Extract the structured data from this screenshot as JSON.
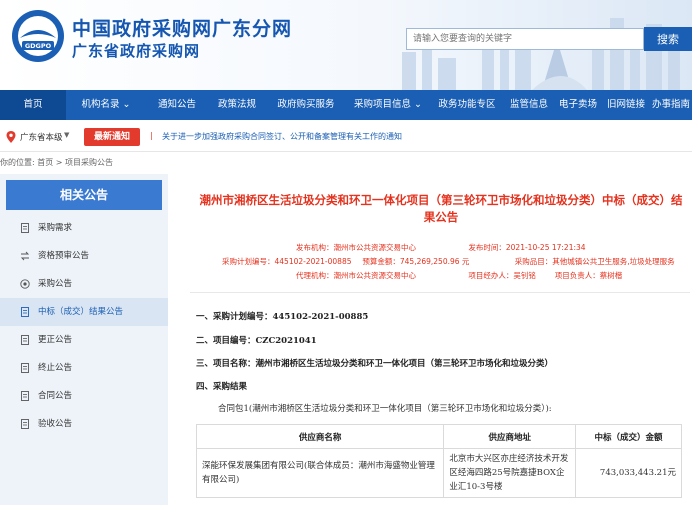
{
  "header": {
    "site_title": "中国政府采购网广东分网",
    "site_subtitle": "广东省政府采购网",
    "logo_text": "GDGPO",
    "search": {
      "placeholder": "请输入您要查询的关键字",
      "button": "搜索"
    }
  },
  "nav": {
    "items": [
      {
        "label": "首页",
        "active": true
      },
      {
        "label": "机构名录 ⌄",
        "active": false
      },
      {
        "label": "通知公告",
        "active": false
      },
      {
        "label": "政策法规",
        "active": false
      },
      {
        "label": "政府购买服务",
        "active": false
      },
      {
        "label": "采购项目信息 ⌄",
        "active": false
      },
      {
        "label": "政务功能专区",
        "active": false
      },
      {
        "label": "监管信息",
        "active": false
      },
      {
        "label": "电子卖场",
        "active": false
      },
      {
        "label": "旧网链接",
        "active": false
      },
      {
        "label": "办事指南",
        "active": false
      }
    ]
  },
  "notice": {
    "location": "广东省本级",
    "badge": "最新通知",
    "separator": "|",
    "text": "关于进一步加强政府采购合同签订、公开和备案管理有关工作的通知"
  },
  "breadcrumb": {
    "text": "你的位置:  首页 > 项目采购公告"
  },
  "sidebar": {
    "title": "相关公告",
    "items": [
      {
        "label": "采购需求",
        "icon": "document-icon",
        "active": false
      },
      {
        "label": "资格预审公告",
        "icon": "exchange-icon",
        "active": false
      },
      {
        "label": "采购公告",
        "icon": "target-icon",
        "active": false
      },
      {
        "label": "中标（成交）结果公告",
        "icon": "document-icon",
        "active": true
      },
      {
        "label": "更正公告",
        "icon": "document-icon",
        "active": false
      },
      {
        "label": "终止公告",
        "icon": "document-icon",
        "active": false
      },
      {
        "label": "合同公告",
        "icon": "document-icon",
        "active": false
      },
      {
        "label": "验收公告",
        "icon": "document-icon",
        "active": false
      }
    ]
  },
  "article": {
    "title": "潮州市湘桥区生活垃圾分类和环卫一体化项目（第三轮环卫市场化和垃圾分类）中标（成交）结果公告",
    "meta": {
      "publisher": "发布机构：潮州市公共资源交易中心",
      "publish_time": "发布时间：2021-10-25 17:21:34",
      "plan_no": "采购计划编号：445102-2021-00885",
      "budget": "预算金额：745,269,250.96 元",
      "category": "采购品目：其他城镇公共卫生服务,垃圾处理服务",
      "agency": "代理机构：潮州市公共资源交易中心",
      "handler": "项目经办人：吴钊铭",
      "manager": "项目负责人：蔡树楷"
    },
    "sections": {
      "s1": "一、采购计划编号：445102-2021-00885",
      "s2": "二、项目编号：CZC2021041",
      "s3": "三、项目名称：潮州市湘桥区生活垃圾分类和环卫一体化项目（第三轮环卫市场化和垃圾分类）",
      "s4": "四、采购结果"
    },
    "contract_para": "合同包1(潮州市湘桥区生活垃圾分类和环卫一体化项目（第三轮环卫市场化和垃圾分类）):",
    "table": {
      "headers": [
        "供应商名称",
        "供应商地址",
        "中标（成交）金额"
      ],
      "rows": [
        {
          "name": "深能环保发展集团有限公司(联合体成员：潮州市海盛物业管理有限公司)",
          "address": "北京市大兴区亦庄经济技术开发区经海四路25号院嘉捷BOX企业汇10-3号楼",
          "amount": "743,033,443.21元"
        }
      ]
    }
  },
  "colors": {
    "brand_blue": "#1a5fb4",
    "nav_active": "#0e4a94",
    "title_red": "#e5321e",
    "badge_red": "#e23b2e",
    "sidebar_bg": "#eef3f9",
    "sidebar_head": "#3b7ad1"
  }
}
